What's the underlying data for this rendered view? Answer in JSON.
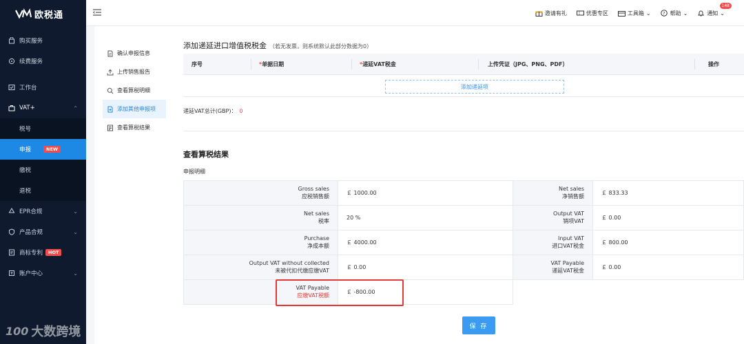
{
  "app": {
    "name": "欧税通",
    "logo_mark": "VM"
  },
  "sidebar": {
    "items": [
      {
        "label": "购买服务",
        "icon": "bag-icon"
      },
      {
        "label": "续费服务",
        "icon": "renew-icon"
      },
      {
        "label": "工作台",
        "icon": "desk-icon"
      },
      {
        "label": "VAT+",
        "icon": "briefcase-icon",
        "expanded": true
      },
      {
        "label": "税号",
        "sub": true
      },
      {
        "label": "申报",
        "sub": true,
        "active": true,
        "badge": "NEW"
      },
      {
        "label": "缴税",
        "sub": true
      },
      {
        "label": "退税",
        "sub": true
      },
      {
        "label": "EPR合规",
        "icon": "recycle-icon"
      },
      {
        "label": "产品合规",
        "icon": "shield-icon"
      },
      {
        "label": "商标专利",
        "icon": "trademark-icon",
        "badge": "HOT"
      },
      {
        "label": "账户中心",
        "icon": "account-icon"
      }
    ]
  },
  "topbar": {
    "invite": "邀请有礼",
    "coupon": "优惠专区",
    "toolbox": "工具箱",
    "help": "帮助",
    "notify": "通知",
    "notify_count": "148"
  },
  "steps": [
    {
      "label": "确认申报信息",
      "icon": "file-check-icon"
    },
    {
      "label": "上传销售报告",
      "icon": "upload-icon"
    },
    {
      "label": "查看算税明细",
      "icon": "search-doc-icon"
    },
    {
      "label": "添加其他申报项",
      "icon": "add-doc-icon",
      "active": true
    },
    {
      "label": "查看算税结果",
      "icon": "result-doc-icon"
    }
  ],
  "deferred": {
    "title": "添加递延进口增值税税金",
    "note": "（若无发票，则系统默认此部分数据为0）",
    "columns": {
      "seq": "序号",
      "date_req": "*",
      "date": "单据日期",
      "vat_req": "*",
      "vat": "递延VAT税金",
      "upload": "上传凭证（JPG、PNG、PDF）",
      "ops": "操作"
    },
    "add_label": "添加递延项",
    "total_label": "递延VAT总计(GBP)：",
    "total_value": "0"
  },
  "result": {
    "title": "查看算税结果",
    "detail_label": "申报明细",
    "rows": [
      {
        "left": {
          "en": "Gross sales",
          "cn": "应税销售额",
          "value": "￡ 1000.00"
        },
        "right": {
          "en": "Net sales",
          "cn": "净销售额",
          "value": "￡ 833.33"
        }
      },
      {
        "left": {
          "en": "Net sales",
          "cn": "税率",
          "value": "20 %"
        },
        "right": {
          "en": "Output VAT",
          "cn": "销项VAT",
          "value": "￡ 0.00"
        }
      },
      {
        "left": {
          "en": "Purchase",
          "cn": "净成本额",
          "value": "￡ 4000.00"
        },
        "right": {
          "en": "Input VAT",
          "cn": "进口VAT税金",
          "value": "￡ 800.00"
        }
      },
      {
        "left": {
          "en": "Output VAT without collected",
          "cn": "未被代扣代缴应缴VAT",
          "value": "￡ 0.00"
        },
        "right": {
          "en": "VAT Payable",
          "cn": "递延VAT税金",
          "value": "￡ 0.00"
        }
      },
      {
        "left": {
          "en": "VAT Payable",
          "cn": "应缴VAT税额",
          "value": "￡ -800.00"
        }
      }
    ]
  },
  "save_label": "保 存",
  "watermark": {
    "logo": "100",
    "text": "大数跨境"
  },
  "colors": {
    "sidebar_bg": "#0f1a2e",
    "accent": "#1e88e5",
    "danger": "#e53935"
  }
}
